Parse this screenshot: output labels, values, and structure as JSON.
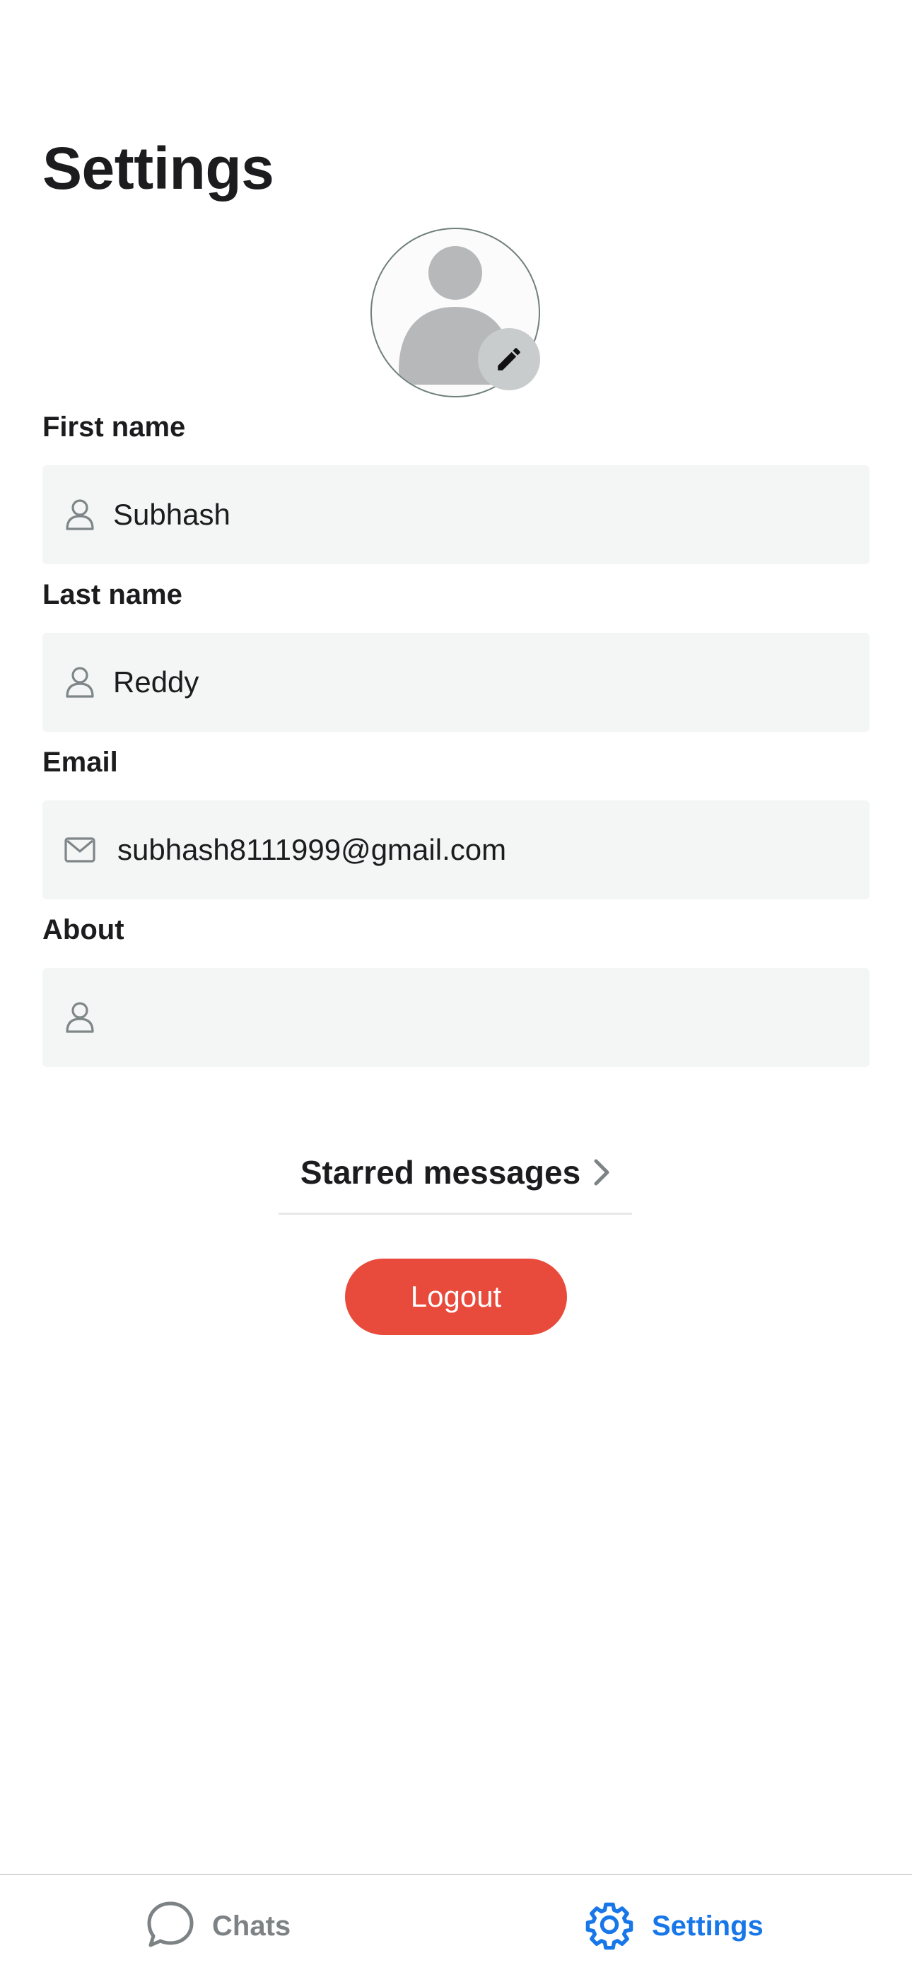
{
  "page": {
    "title": "Settings"
  },
  "profile": {
    "avatar_icon": "person-placeholder-icon",
    "edit_icon": "pencil-icon"
  },
  "form": {
    "first_name": {
      "label": "First name",
      "value": "Subhash",
      "icon": "person-icon"
    },
    "last_name": {
      "label": "Last name",
      "value": "Reddy",
      "icon": "person-icon"
    },
    "email": {
      "label": "Email",
      "value": "subhash8111999@gmail.com",
      "icon": "mail-icon"
    },
    "about": {
      "label": "About",
      "value": "",
      "icon": "person-icon"
    }
  },
  "starred": {
    "label": "Starred messages",
    "icon": "chevron-right-icon"
  },
  "logout": {
    "label": "Logout",
    "color": "#e84a3c"
  },
  "tabbar": {
    "tabs": [
      {
        "label": "Chats",
        "icon": "chat-bubble-icon",
        "active": false
      },
      {
        "label": "Settings",
        "icon": "gear-icon",
        "active": true
      }
    ],
    "active_color": "#1877e8",
    "inactive_color": "#7d8285"
  }
}
